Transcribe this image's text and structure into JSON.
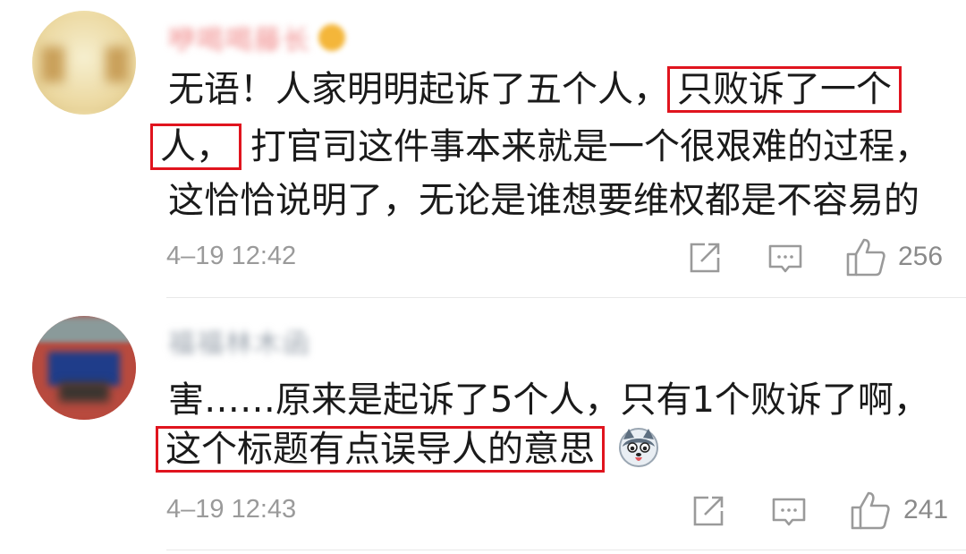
{
  "comments": [
    {
      "username": "咿喝喝藤长",
      "lines": [
        {
          "plain": "无语！人家明明起诉了五个人，",
          "highlight": "只败诉了一个"
        },
        {
          "highlight": "人，",
          "plain": "打官司这件事本来就是一个很艰难的过程，"
        },
        {
          "plain": "这恰恰说明了，无论是谁想要维权都是不容易的"
        }
      ],
      "time": "4–19 12:42",
      "likes": "256"
    },
    {
      "username": "福福林木函",
      "lines": [
        {
          "plain": "害……原来是起诉了5个人，只有1个败诉了啊，"
        },
        {
          "highlight": "这个标题有点误导人的意思"
        }
      ],
      "time": "4–19 12:43",
      "likes": "241"
    }
  ],
  "icons": {
    "share": "share-icon",
    "comment": "comment-icon",
    "like": "thumbs-up-icon",
    "emoji": "husky-emoji-icon"
  },
  "colors": {
    "highlight_border": "#e0141e",
    "meta_text": "#9a9a9a",
    "body_text": "#1a1a1a"
  }
}
